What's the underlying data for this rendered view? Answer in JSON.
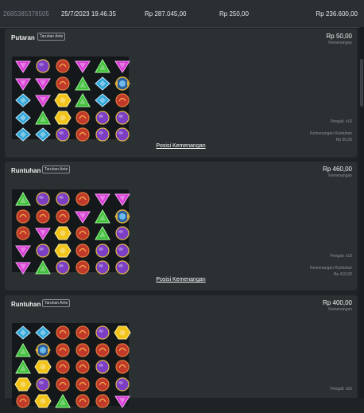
{
  "header": {
    "transaction_id": "2685385378505",
    "datetime": "25/7/2023 19.46.35",
    "bet": "Rp 287.045,00",
    "win": "Rp 250,00",
    "balance": "Rp 236.600,00"
  },
  "panels": [
    {
      "title": "Putaran",
      "tag": "Taruhan Ante",
      "amount": "Rp 50,00",
      "amount_label": "Kemenangan",
      "multiplier": "Pengali: x10",
      "cascade_label": "Kemenangan Runtuhan",
      "cascade_value": "Rp 50,00",
      "link": "Posisi Kemenangan",
      "grid": [
        [
          "magenta",
          "purple",
          "red",
          "magenta",
          "green",
          "magenta"
        ],
        [
          "magenta",
          "magenta",
          "red",
          "green",
          "blue",
          "orb"
        ],
        [
          "blue",
          "magenta",
          "yellow",
          "green",
          "blue",
          "red"
        ],
        [
          "blue",
          "green",
          "yellow",
          "red",
          "purple",
          "purple"
        ],
        [
          "blue",
          "blue",
          "purple",
          "red",
          "purple",
          "purple"
        ]
      ]
    },
    {
      "title": "Runtuhan",
      "tag": "Taruhan Ante",
      "amount": "Rp 460,00",
      "amount_label": "Kemenangan",
      "multiplier": "Pengali: x10",
      "cascade_label": "Kemenangan Runtuhan",
      "cascade_value": "Rp 410,00",
      "link": "Posisi Kemenangan",
      "grid": [
        [
          "green",
          "purple",
          "purple",
          "red",
          "magenta",
          "magenta"
        ],
        [
          "red",
          "red",
          "red",
          "magenta",
          "green",
          "orb"
        ],
        [
          "red",
          "magenta",
          "yellow",
          "red",
          "green",
          "purple"
        ],
        [
          "magenta",
          "purple",
          "yellow",
          "red",
          "purple",
          "purple"
        ],
        [
          "magenta",
          "green",
          "purple",
          "red",
          "purple",
          "purple"
        ]
      ]
    },
    {
      "title": "Runtuhan",
      "tag": "Taruhan Ante",
      "amount": "Rp 400,00",
      "amount_label": "Kemenangan",
      "multiplier": "Pengali: x60",
      "grid": [
        [
          "blue",
          "blue",
          "red",
          "red",
          "purple",
          "yellow"
        ],
        [
          "green",
          "orb",
          "red",
          "red",
          "red",
          "red"
        ],
        [
          "green",
          "yellow",
          "red",
          "red",
          "purple",
          "red"
        ],
        [
          "yellow",
          "purple",
          "red",
          "red",
          "red",
          "purple"
        ],
        [
          "red",
          "yellow",
          "green",
          "red",
          "red",
          "magenta"
        ]
      ]
    }
  ],
  "gem_colors": {
    "magenta": "#d93bd6",
    "purple": "#7c3fc4",
    "red": "#c0392b",
    "green": "#3fbf3a",
    "blue": "#2fa5d8",
    "yellow": "#f2c418",
    "orb": "#2a5fa0"
  }
}
